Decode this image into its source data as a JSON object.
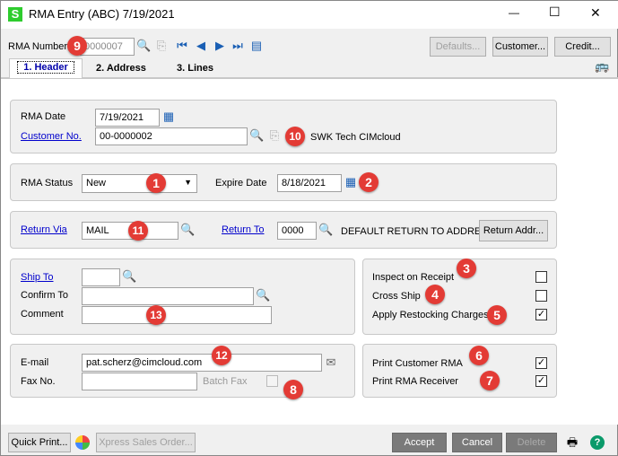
{
  "window": {
    "title": "RMA Entry (ABC) 7/19/2021",
    "app_icon_letter": "S",
    "minimize": "—",
    "maximize": "☐",
    "close": "✕"
  },
  "toolbar": {
    "rma_number_label": "RMA Number",
    "rma_number_value": "0000007",
    "defaults": "Defaults...",
    "customer": "Customer...",
    "credit": "Credit..."
  },
  "tabs": [
    {
      "label": "1. Header",
      "selected": true
    },
    {
      "label": "2. Address"
    },
    {
      "label": "3. Lines"
    }
  ],
  "header": {
    "rma_date_label": "RMA Date",
    "rma_date": "7/19/2021",
    "customer_no_label": "Customer No.",
    "customer_no": "00-0000002",
    "customer_name": "SWK Tech CIMcloud",
    "rma_status_label": "RMA Status",
    "rma_status": "New",
    "expire_date_label": "Expire Date",
    "expire_date": "8/18/2021",
    "return_via_label": "Return Via",
    "return_via": "MAIL",
    "return_to_label": "Return To",
    "return_to": "0000",
    "return_to_desc": "DEFAULT RETURN TO ADDRES",
    "return_addr_button": "Return Addr...",
    "ship_to_label": "Ship To",
    "ship_to": "",
    "confirm_to_label": "Confirm To",
    "confirm_to": "",
    "comment_label": "Comment",
    "comment": "",
    "email_label": "E-mail",
    "email": "pat.scherz@cimcloud.com",
    "fax_label": "Fax No.",
    "fax": "",
    "batch_fax_label": "Batch Fax",
    "batch_fax": false,
    "inspect_label": "Inspect on Receipt",
    "inspect": false,
    "cross_ship_label": "Cross Ship",
    "cross_ship": false,
    "restocking_label": "Apply Restocking Charges",
    "restocking": true,
    "print_customer_rma_label": "Print Customer RMA",
    "print_customer_rma": true,
    "print_rma_receiver_label": "Print RMA Receiver",
    "print_rma_receiver": true
  },
  "badges": [
    "1",
    "2",
    "3",
    "4",
    "5",
    "6",
    "7",
    "8",
    "9",
    "10",
    "11",
    "12",
    "13"
  ],
  "footer": {
    "quick_print": "Quick Print...",
    "xpress": "Xpress Sales Order...",
    "accept": "Accept",
    "cancel": "Cancel",
    "delete": "Delete"
  },
  "colors": {
    "badge": "#e33b35",
    "link": "#0000cc",
    "dark_button": "#7a7a7a"
  }
}
